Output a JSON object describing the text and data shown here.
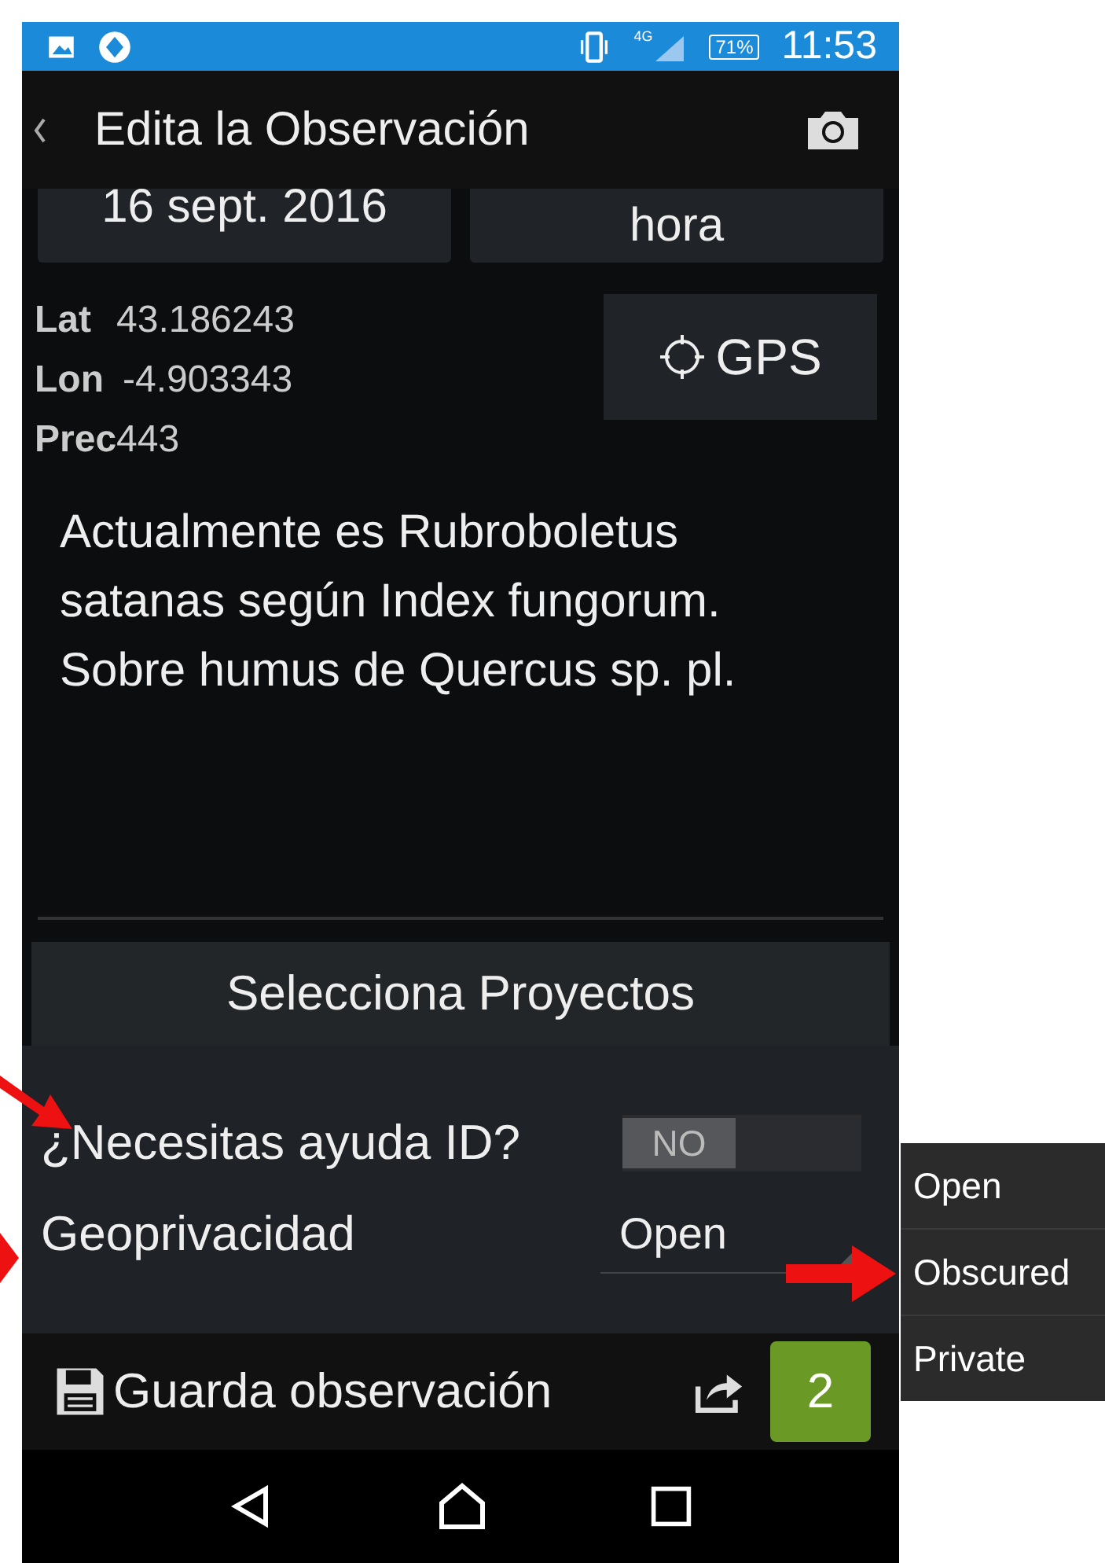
{
  "status_bar": {
    "network": "4G",
    "battery": "71%",
    "time": "11:53"
  },
  "toolbar": {
    "title": "Edita la Observación"
  },
  "date_buttons": [
    {
      "label": "16 sept. 2016"
    },
    {
      "label": "hora"
    }
  ],
  "location": {
    "fields": [
      {
        "label": "Lat",
        "value": "43.186243"
      },
      {
        "label": "Lon",
        "value": "-4.903343"
      },
      {
        "label": "Prec",
        "value": "443"
      }
    ],
    "gps_button": "GPS"
  },
  "notes": {
    "value": "Actualmente es Rubroboletus satanas según Index fungorum. Sobre humus de Quercus sp. pl."
  },
  "projects_button": "Selecciona Proyectos",
  "help_id": {
    "label": "¿Necesitas ayuda ID?",
    "toggle_text": "NO",
    "on": false
  },
  "geoprivacy": {
    "label": "Geoprivacidad",
    "value": "Open"
  },
  "bottom_bar": {
    "save_label": "Guarda observación",
    "count": "2"
  },
  "geoprivacy_menu": [
    {
      "label": "Open"
    },
    {
      "label": "Obscured"
    },
    {
      "label": "Private"
    }
  ]
}
